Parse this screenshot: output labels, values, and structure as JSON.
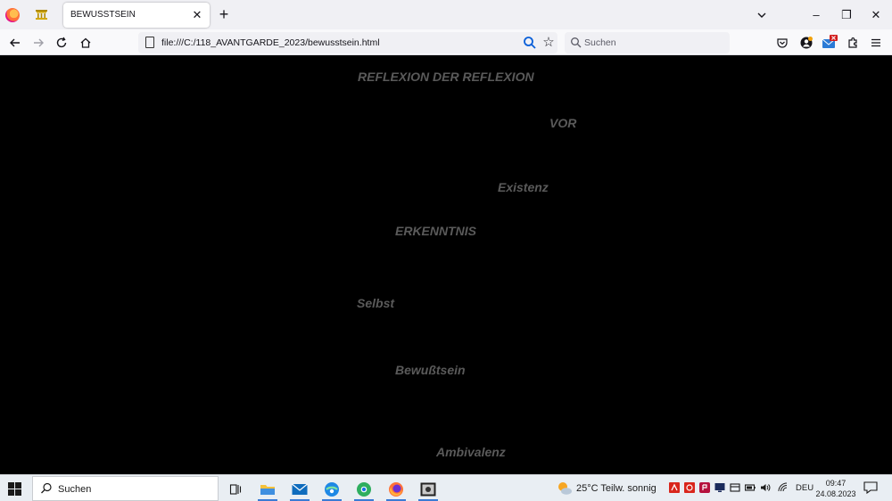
{
  "browser": {
    "tab_title": "BEWUSSTSEIN",
    "tab_close": "✕",
    "new_tab": "+",
    "url": "file:///C:/118_AVANTGARDE_2023/bewusstsein.html",
    "search_placeholder": "Suchen",
    "window_controls": {
      "minimize": "–",
      "restore": "❐",
      "close": "✕"
    }
  },
  "page": {
    "background": "#000000",
    "text_color": "#5a5a5a",
    "words": [
      "REFLEXION DER REFLEXION",
      "VOR",
      "Existenz",
      "ERKENNTNIS",
      "Selbst",
      "Bewußtsein",
      "Ambivalenz"
    ]
  },
  "taskbar": {
    "search_label": "Suchen",
    "weather_text": "25°C  Teilw. sonnig",
    "language": "DEU",
    "time": "09:47",
    "date": "24.08.2023",
    "accent": "#3a7bd5"
  }
}
